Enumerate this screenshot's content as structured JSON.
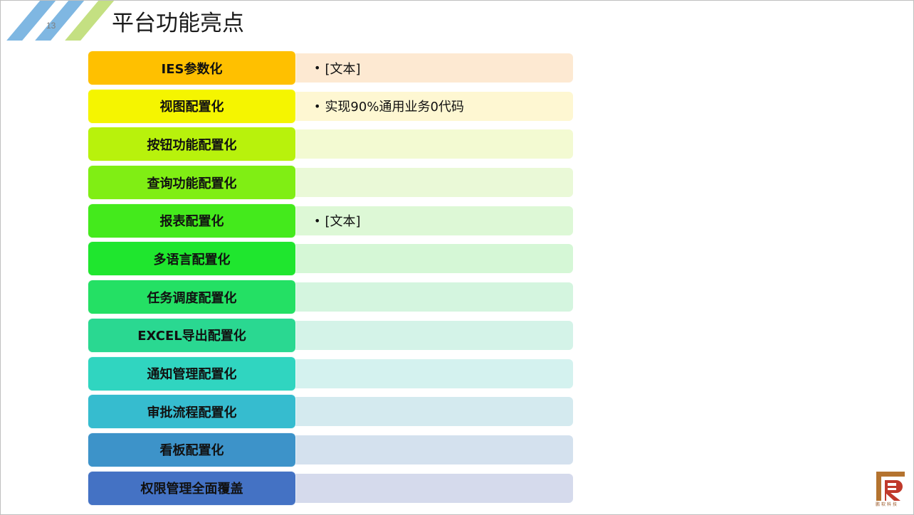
{
  "slide": {
    "page_number": "13",
    "title": "平台功能亮点"
  },
  "rows": [
    {
      "label": "IES参数化",
      "text": "[文本]",
      "label_color": "#FFC000",
      "content_color": "#FDE9D2"
    },
    {
      "label": "视图配置化",
      "text": "实现90%通用业务0代码",
      "label_color": "#F5F500",
      "content_color": "#FEF7D2"
    },
    {
      "label": "按钮功能配置化",
      "text": "",
      "label_color": "#B8F20C",
      "content_color": "#F3FAD2"
    },
    {
      "label": "查询功能配置化",
      "text": "",
      "label_color": "#80EE14",
      "content_color": "#EAF9D7"
    },
    {
      "label": "报表配置化",
      "text": "[文本]",
      "label_color": "#44EA1C",
      "content_color": "#DDF8D6"
    },
    {
      "label": "多语言配置化",
      "text": "",
      "label_color": "#1FE62E",
      "content_color": "#D5F7D6"
    },
    {
      "label": "任务调度配置化",
      "text": "",
      "label_color": "#24E064",
      "content_color": "#D4F5DF"
    },
    {
      "label": "EXCEL导出配置化",
      "text": "",
      "label_color": "#2AD891",
      "content_color": "#D4F3E8"
    },
    {
      "label": "通知管理配置化",
      "text": "",
      "label_color": "#30D5C0",
      "content_color": "#D4F2EF"
    },
    {
      "label": "审批流程配置化",
      "text": "",
      "label_color": "#36BCCF",
      "content_color": "#D4EAEF"
    },
    {
      "label": "看板配置化",
      "text": "",
      "label_color": "#3D93C9",
      "content_color": "#D4E1EE"
    },
    {
      "label": "权限管理全面覆盖",
      "text": "",
      "label_color": "#4472C4",
      "content_color": "#D5DAEC"
    }
  ],
  "logo": {
    "caption": "鹏软科技",
    "icon": "company-logo-r-icon",
    "color": "#A0521E"
  },
  "decoration": {
    "stripe_colors": [
      "#7FB7E2",
      "#7FB7E2",
      "#C4E082"
    ]
  }
}
